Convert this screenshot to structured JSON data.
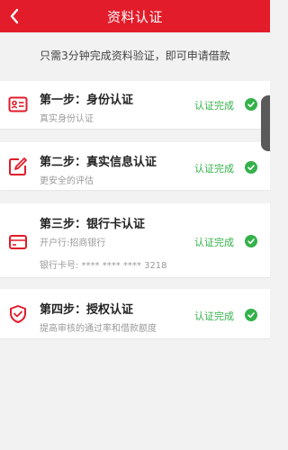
{
  "header": {
    "title": "资料认证",
    "back_icon": "chevron-left-icon"
  },
  "notice": "只需3分钟完成资料验证，即可申请借款",
  "colors": {
    "brand": "#e21c2a",
    "success": "#35b14b",
    "background": "#f2f2f2"
  },
  "steps": [
    {
      "icon": "id-card-icon",
      "title": "第一步：身份认证",
      "desc": "真实身份认证",
      "status": "认证完成"
    },
    {
      "icon": "edit-icon",
      "title": "第二步：真实信息认证",
      "desc": "更安全的评估",
      "status": "认证完成"
    },
    {
      "icon": "bank-card-icon",
      "title": "第三步：银行卡认证",
      "desc": "开户行:招商银行",
      "desc2": "银行卡号: **** **** **** 3218",
      "status": "认证完成"
    },
    {
      "icon": "shield-check-icon",
      "title": "第四步：授权认证",
      "desc": "提高审核的通过率和借款额度",
      "status": "认证完成"
    }
  ]
}
